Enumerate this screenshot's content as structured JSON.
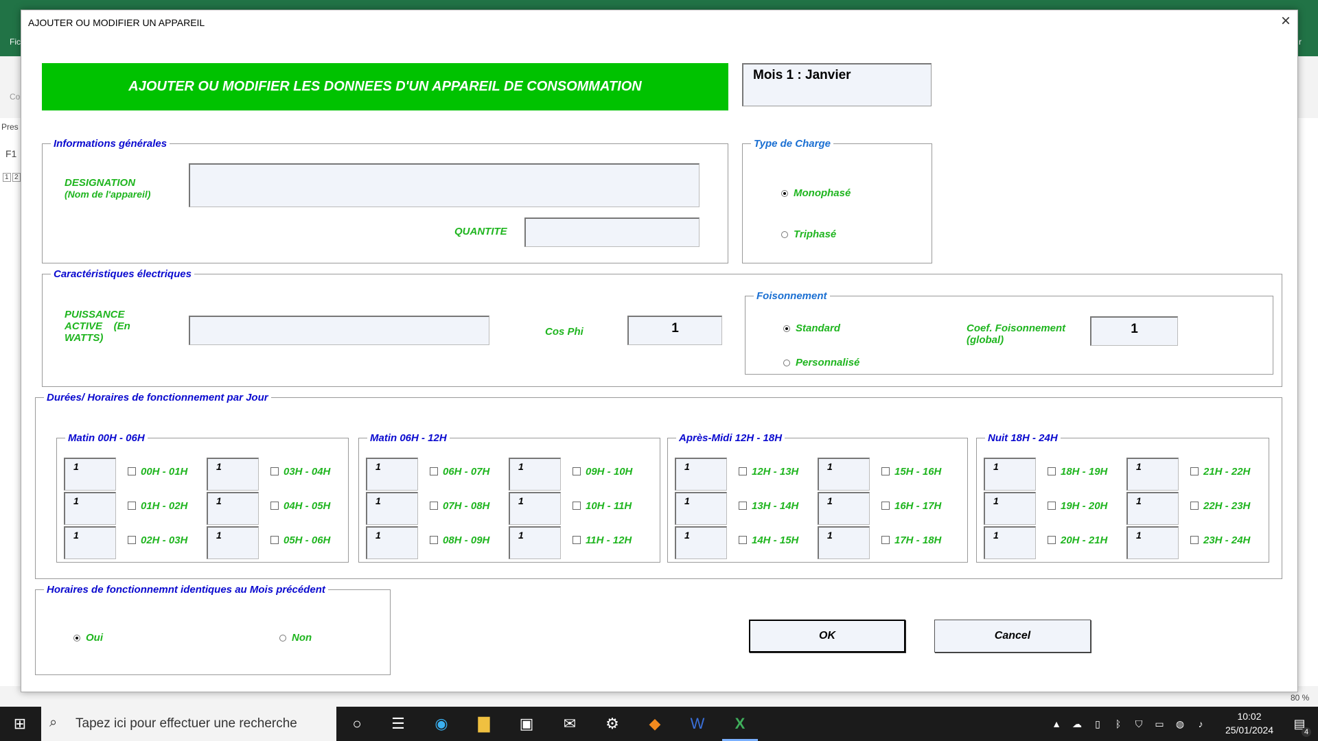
{
  "excel": {
    "menu_first": "Fic",
    "ribbon_cut": "Co",
    "name_box": "F1",
    "presse": "Pres",
    "zoom": "80 %",
    "levels": [
      "1",
      "2"
    ],
    "right_edge": "r"
  },
  "dialog": {
    "title": "AJOUTER OU MODIFIER UN APPAREIL",
    "close": "×",
    "banner": "AJOUTER OU MODIFIER LES DONNEES D'UN APPAREIL DE CONSOMMATION",
    "month": "Mois 1 : Janvier"
  },
  "info": {
    "legend": "Informations générales",
    "designation_label_1": "DESIGNATION",
    "designation_label_2": "(Nom de l'appareil)",
    "designation_value": "",
    "quantite_label": "QUANTITE",
    "quantite_value": ""
  },
  "charge": {
    "legend": "Type de Charge",
    "mono": "Monophasé",
    "tri": "Triphasé"
  },
  "elec": {
    "legend": "Caractéristiques électriques",
    "puissance_1": "PUISSANCE",
    "puissance_2": "ACTIVE    (En",
    "puissance_3": "WATTS)",
    "puissance_value": "",
    "cosphi_label": "Cos Phi",
    "cosphi_value": "1"
  },
  "foison": {
    "legend": "Foisonnement",
    "standard": "Standard",
    "perso": "Personnalisé",
    "coef_1": "Coef. Foisonnement",
    "coef_2": "(global)",
    "coef_value": "1"
  },
  "durees": {
    "legend": "Durées/ Horaires de fonctionnement par Jour",
    "groups": [
      {
        "title": "Matin 00H - 06H",
        "slots": [
          "00H - 01H",
          "01H - 02H",
          "02H - 03H",
          "03H - 04H",
          "04H - 05H",
          "05H - 06H"
        ]
      },
      {
        "title": "Matin 06H - 12H",
        "slots": [
          "06H - 07H",
          "07H - 08H",
          "08H - 09H",
          "09H - 10H",
          "10H - 11H",
          "11H - 12H"
        ]
      },
      {
        "title": "Après-Midi 12H - 18H",
        "slots": [
          "12H - 13H",
          "13H - 14H",
          "14H - 15H",
          "15H - 16H",
          "16H - 17H",
          "17H - 18H"
        ]
      },
      {
        "title": "Nuit 18H - 24H",
        "slots": [
          "18H - 19H",
          "19H - 20H",
          "20H - 21H",
          "21H - 22H",
          "22H - 23H",
          "23H - 24H"
        ]
      }
    ],
    "default_value": "1"
  },
  "identique": {
    "legend": "Horaires de fonctionnemnt identiques au Mois précédent",
    "oui": "Oui",
    "non": "Non"
  },
  "buttons": {
    "ok": "OK",
    "cancel": "Cancel"
  },
  "taskbar": {
    "search_placeholder": "Tapez ici pour effectuer une recherche",
    "time": "10:02",
    "date": "25/01/2024",
    "notif_count": "4"
  }
}
